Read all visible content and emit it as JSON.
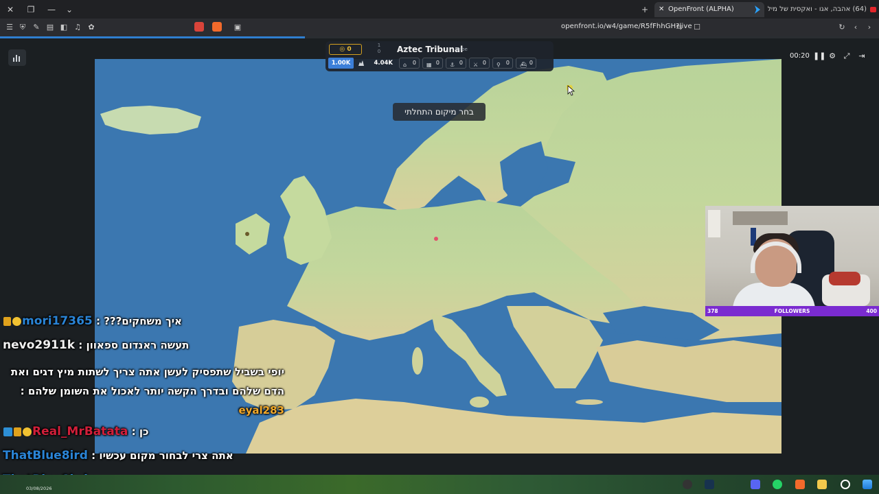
{
  "browser": {
    "active_tab_title": "OpenFront (ALPHA)",
    "other_tab_title": "(64) אהבה, אגו - ואקסית של מיליארד",
    "url": "openfront.io/w4/game/R5fFhhGH?live"
  },
  "hud": {
    "gold": "0",
    "rank_top": "1",
    "rank_bottom": "0",
    "nation_name": "Aztec Tribunal",
    "nation_type": "Tribe",
    "population": "1.00K",
    "max_population": "4.04K",
    "units": [
      {
        "icon": "city-icon",
        "glyph": "⌂",
        "value": "0"
      },
      {
        "icon": "factory-icon",
        "glyph": "▦",
        "value": "0"
      },
      {
        "icon": "port-icon",
        "glyph": "⚓",
        "value": "0"
      },
      {
        "icon": "defense-post-icon",
        "glyph": "⚔",
        "value": "0"
      },
      {
        "icon": "missile-silo-icon",
        "glyph": "⚲",
        "value": "0"
      },
      {
        "icon": "warship-icon",
        "glyph": "⛴",
        "value": "0"
      }
    ]
  },
  "tooltip": "בחר מיקום התחלתי",
  "controls": {
    "timer": "00:20"
  },
  "stream": {
    "followers_label": "FOLLOWERS",
    "followers_current": "378",
    "followers_goal": "400",
    "followers_progress": 0.945
  },
  "chat": [
    {
      "name": "mori17365",
      "name_color": "#2a84d6",
      "message": "איך משחקים???",
      "badges": [
        "trophy",
        "gold"
      ]
    },
    {
      "name": "nevo2911k",
      "name_color": "#f0f0f0",
      "message": "תעשה ראנדום ספאוון",
      "badges": []
    },
    {
      "name": "eyal283",
      "name_color": "#f2a92a",
      "message": "יופי בשביל שתפסיק לעשן אתה צריך לשתות מיץ דגים ואת הדם שלהם ובדרך הקשה יותר לאכול את השומן שלהם",
      "badges": []
    },
    {
      "name": "Real_MrBatata",
      "name_color": "#d21f3a",
      "message": "כן",
      "badges": [
        "blue",
        "trophy",
        "gold"
      ]
    },
    {
      "name": "ThatBlue8ird",
      "name_color": "#2a84d6",
      "message": "אתה צרי לבחור מקום עכשיו",
      "badges": []
    },
    {
      "name": "ThatBlue8ird",
      "name_color": "#2a84d6",
      "message": "תבחר מקום",
      "badges": []
    }
  ],
  "taskbar": {
    "date": "03/08/2026"
  }
}
